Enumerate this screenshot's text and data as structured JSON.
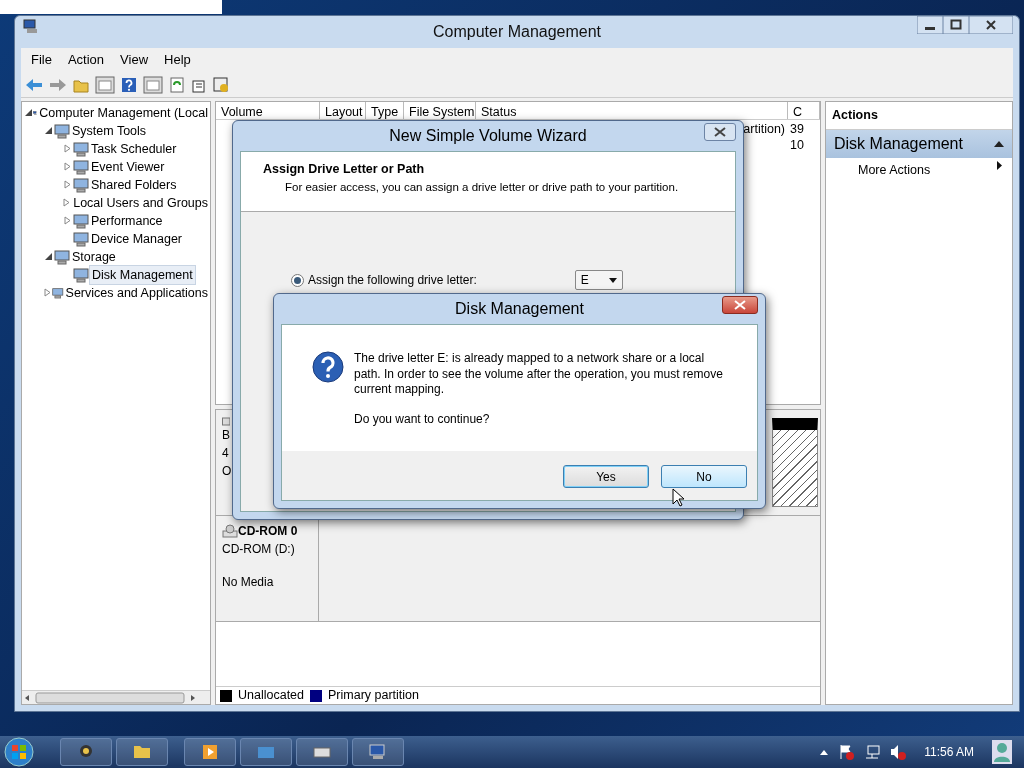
{
  "window": {
    "title": "Computer Management"
  },
  "menu": [
    "File",
    "Action",
    "View",
    "Help"
  ],
  "tree": [
    {
      "label": "Computer Management (Local",
      "expanded": true,
      "selected": false,
      "children": [
        {
          "label": "System Tools",
          "expanded": true,
          "selected": false,
          "children": [
            {
              "label": "Task Scheduler",
              "expanded": false,
              "selected": false
            },
            {
              "label": "Event Viewer",
              "expanded": false,
              "selected": false
            },
            {
              "label": "Shared Folders",
              "expanded": false,
              "selected": false
            },
            {
              "label": "Local Users and Groups",
              "expanded": false,
              "selected": false
            },
            {
              "label": "Performance",
              "expanded": false,
              "selected": false
            },
            {
              "label": "Device Manager",
              "selected": false
            }
          ]
        },
        {
          "label": "Storage",
          "expanded": true,
          "selected": false,
          "children": [
            {
              "label": "Disk Management",
              "selected": true
            }
          ]
        },
        {
          "label": "Services and Applications",
          "expanded": false,
          "selected": false
        }
      ]
    }
  ],
  "volume_list": {
    "columns": [
      "Volume",
      "Layout",
      "Type",
      "File System",
      "Status",
      "C"
    ],
    "rows": [
      {
        "status": "artition)",
        "column_6": "39"
      },
      {
        "column_6": "10"
      }
    ]
  },
  "disks": [
    {
      "kind": "disk",
      "lines": [
        "B",
        "4",
        "O"
      ]
    },
    {
      "kind": "cdrom",
      "name": "CD-ROM 0",
      "lines": [
        "CD-ROM (D:)",
        "No Media"
      ]
    }
  ],
  "legend": [
    {
      "label": "Unallocated",
      "color": "#000000"
    },
    {
      "label": "Primary partition",
      "color": "#000080"
    }
  ],
  "actions": {
    "title": "Actions",
    "section": "Disk Management",
    "items": [
      "More Actions"
    ]
  },
  "wizard": {
    "title": "New Simple Volume Wizard",
    "heading": "Assign Drive Letter or Path",
    "subtitle": "For easier access, you can assign a drive letter or drive path to your partition.",
    "option": {
      "label": "Assign the following drive letter:",
      "selected": true
    },
    "drive_letter": "E"
  },
  "message_box": {
    "title": "Disk Management",
    "message": "The drive letter E: is already mapped to a network share or a local path. In order to see the volume after the operation, you must remove current mapping.",
    "question": "Do you want to continue?",
    "buttons": [
      {
        "label": "Yes",
        "hovered": false
      },
      {
        "label": "No",
        "hovered": true
      }
    ]
  },
  "taskbar": {
    "clock": "11:56 AM"
  }
}
